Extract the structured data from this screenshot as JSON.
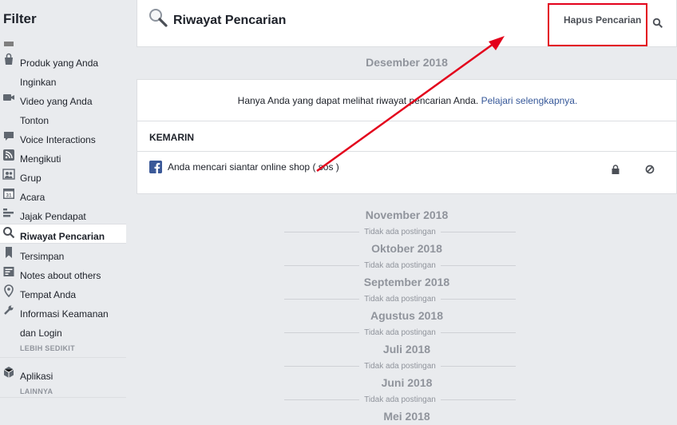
{
  "sidebar": {
    "title": "Filter",
    "items": [
      {
        "name": "sidebar-item-produk",
        "label": "Produk yang Anda",
        "label2": "Inginkan",
        "icon": "shopping-bag-icon"
      },
      {
        "name": "sidebar-item-video",
        "label": "Video yang Anda",
        "label2": "Tonton",
        "icon": "video-camera-icon"
      },
      {
        "name": "sidebar-item-voice",
        "label": "Voice Interactions",
        "icon": "speech-bubble-icon"
      },
      {
        "name": "sidebar-item-mengikuti",
        "label": "Mengikuti",
        "icon": "rss-icon"
      },
      {
        "name": "sidebar-item-grup",
        "label": "Grup",
        "icon": "group-icon"
      },
      {
        "name": "sidebar-item-acara",
        "label": "Acara",
        "icon": "calendar-icon"
      },
      {
        "name": "sidebar-item-jajak",
        "label": "Jajak Pendapat",
        "icon": "poll-icon"
      },
      {
        "name": "sidebar-item-riwayat",
        "label": "Riwayat Pencarian",
        "icon": "search-icon"
      },
      {
        "name": "sidebar-item-tersimpan",
        "label": "Tersimpan",
        "icon": "bookmark-icon"
      },
      {
        "name": "sidebar-item-notes",
        "label": "Notes about others",
        "icon": "note-icon"
      },
      {
        "name": "sidebar-item-tempat",
        "label": "Tempat Anda",
        "icon": "location-pin-icon"
      },
      {
        "name": "sidebar-item-keamanan",
        "label": "Informasi Keamanan",
        "label2": "dan Login",
        "icon": "wrench-icon"
      },
      {
        "name": "sidebar-item-aplikasi",
        "label": "Aplikasi",
        "icon": "cube-icon"
      }
    ],
    "lebih_sedikit": "LEBIH SEDIKIT",
    "lainnya": "LAINNYA"
  },
  "header": {
    "title": "Riwayat Pencarian",
    "hapus": "Hapus Pencarian"
  },
  "months": {
    "desember": "Desember 2018",
    "november": "November 2018",
    "oktober": "Oktober 2018",
    "september": "September 2018",
    "agustus": "Agustus 2018",
    "juli": "Juli 2018",
    "juni": "Juni 2018",
    "mei": "Mei 2018"
  },
  "empty_label": "Tidak ada postingan",
  "card": {
    "info_text": "Hanya Anda yang dapat melihat riwayat pencarian Anda.",
    "info_link": "Pelajari selengkapnya.",
    "section_title": "KEMARIN",
    "row_text": "Anda mencari siantar online shop ( sos )"
  },
  "colors": {
    "annotation_red": "#e3001b",
    "link_blue": "#365899",
    "facebook_blue": "#3b5998"
  }
}
